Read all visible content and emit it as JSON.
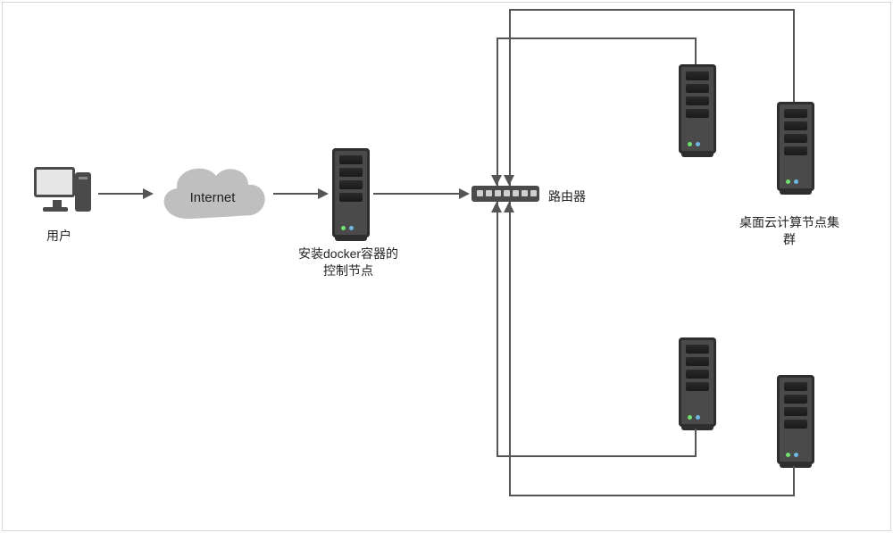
{
  "labels": {
    "user": "用户",
    "cloud": "Internet",
    "control_node": "安装docker容器的\n控制节点",
    "router": "路由器",
    "cluster": "桌面云计算节点集\n群"
  },
  "icons": {
    "desktop": "desktop-computer-icon",
    "cloud": "cloud-icon",
    "server": "server-tower-icon",
    "router": "router-icon"
  },
  "colors": {
    "line": "#555555",
    "server_body": "#4a4a4a",
    "cloud_fill": "#bfbfbf"
  }
}
